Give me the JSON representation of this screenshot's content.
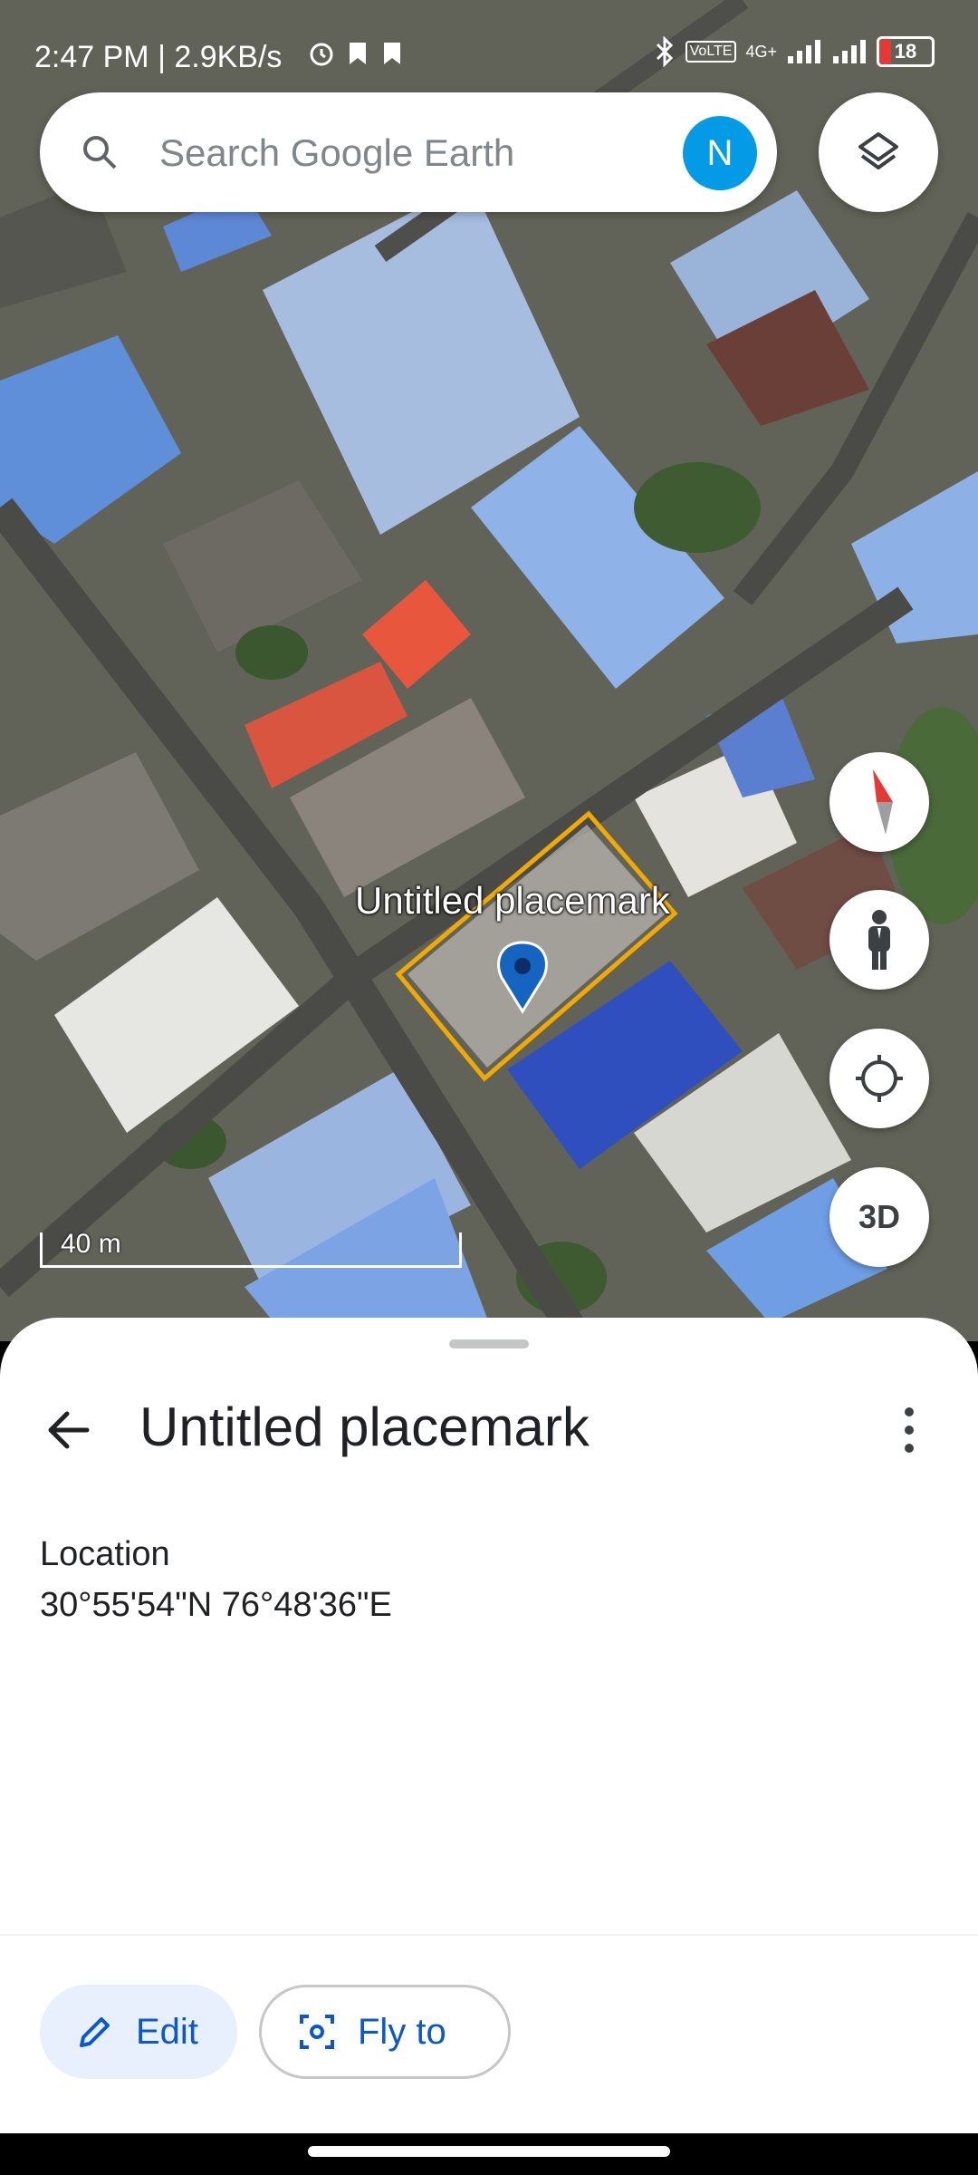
{
  "status_bar": {
    "time": "2:47 PM | 2.9KB/s",
    "network": "4G+",
    "battery": "18"
  },
  "search": {
    "placeholder": "Search Google Earth",
    "avatar_letter": "N"
  },
  "map": {
    "placemark_label": "Untitled placemark",
    "scale_label": "40 m",
    "three_d_label": "3D"
  },
  "sheet": {
    "title": "Untitled placemark",
    "location_label": "Location",
    "location_value": "30°55'54\"N 76°48'36\"E",
    "edit_label": "Edit",
    "fly_to_label": "Fly to"
  },
  "colors": {
    "accent": "#0b57d0",
    "avatar": "#039be5",
    "placemark_outline": "#f2a900",
    "pin": "#1565c0"
  },
  "icons": [
    "search-icon",
    "layers-icon",
    "compass-icon",
    "pegman-icon",
    "my-location-icon",
    "back-arrow-icon",
    "more-vert-icon",
    "pencil-icon",
    "fly-to-icon",
    "map-pin-icon"
  ]
}
